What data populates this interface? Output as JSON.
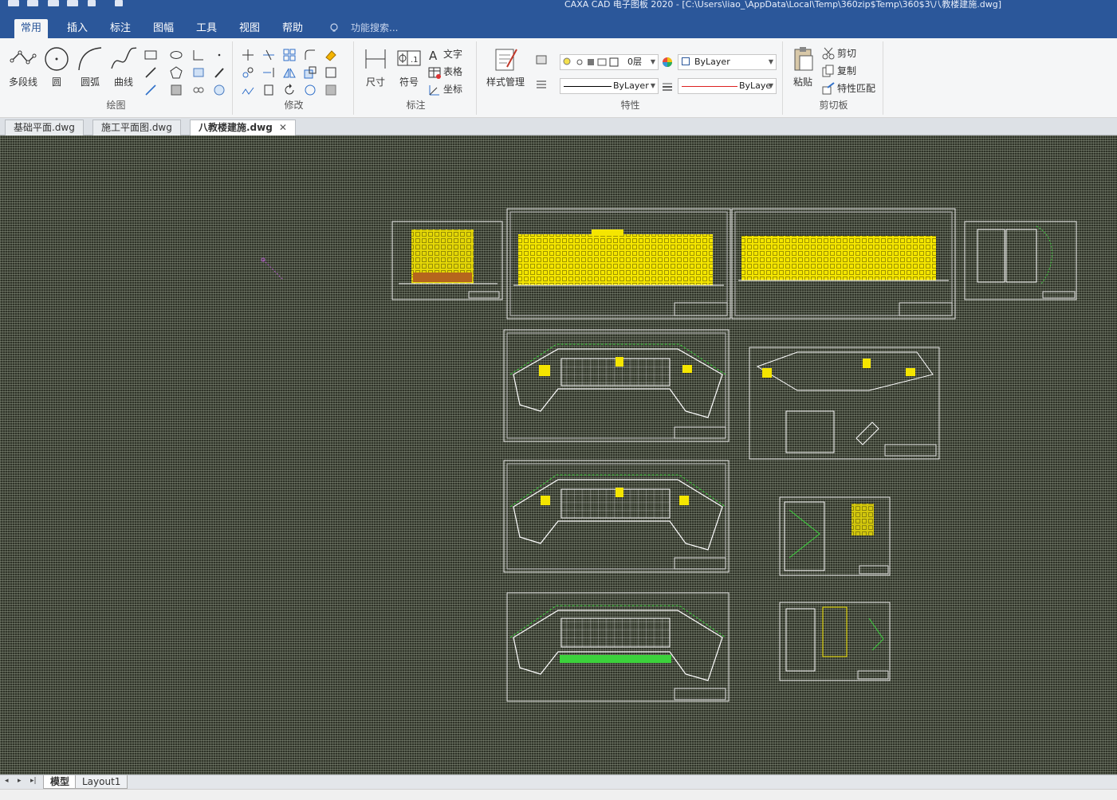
{
  "window": {
    "title": "CAXA CAD 电子图板 2020 - [C:\\Users\\liao_\\AppData\\Local\\Temp\\360zip$Temp\\360$3\\八教楼建施.dwg]"
  },
  "ribbon_tabs": [
    "常用",
    "插入",
    "标注",
    "图幅",
    "工具",
    "视图",
    "帮助"
  ],
  "search": {
    "placeholder": "功能搜索..."
  },
  "draw_group": {
    "label": "绘图",
    "polyline": "多段线",
    "circle": "圆",
    "arc": "圆弧",
    "curve": "曲线"
  },
  "modify_group": {
    "label": "修改"
  },
  "annotate_group": {
    "label": "标注",
    "dimension": "尺寸",
    "symbol": "符号",
    "text": "文字",
    "table": "表格",
    "coordinate": "坐标"
  },
  "properties_group": {
    "label": "特性",
    "style_manager": "样式管理",
    "layer_value": "0层",
    "color_value": "ByLayer",
    "linetype_value": "ByLayer",
    "lineweight_value": "ByLaye"
  },
  "clipboard_group": {
    "label": "剪切板",
    "paste": "粘贴",
    "cut": "剪切",
    "copy": "复制",
    "match": "特性匹配"
  },
  "document_tabs": [
    {
      "name": "基础平面.dwg"
    },
    {
      "name": "施工平面图.dwg"
    },
    {
      "name": "八教楼建施.dwg"
    }
  ],
  "layout_tabs": [
    "模型",
    "Layout1"
  ],
  "colors": {
    "title_bar": "#2b579a",
    "ribbon_bg": "#f5f6f7",
    "canvas_bg": "#2f3328",
    "drawing_yellow": "#f5e600",
    "drawing_green": "#3cd23c"
  }
}
